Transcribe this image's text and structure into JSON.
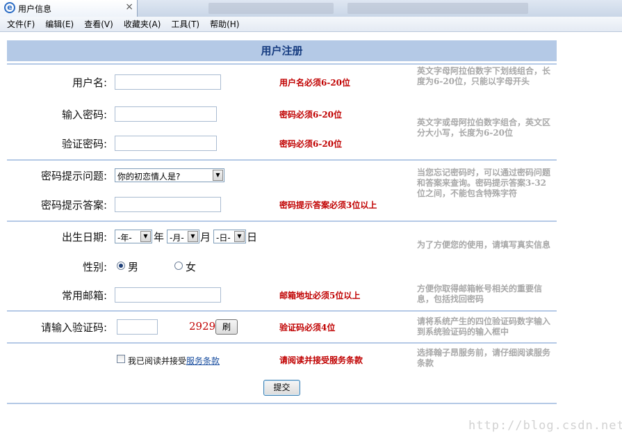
{
  "browser": {
    "tab_title": "用户信息",
    "tab_icon": "ie-icon",
    "close_glyph": "×"
  },
  "menu": [
    "文件(F)",
    "编辑(E)",
    "查看(V)",
    "收藏夹(A)",
    "工具(T)",
    "帮助(H)"
  ],
  "form": {
    "title": "用户注册",
    "username": {
      "label": "用户名:",
      "value": "",
      "error": "用户名必须6-20位",
      "hint": "英文字母阿拉伯数字下划线组合，长度为6-20位，只能以字母开头"
    },
    "password": {
      "label": "输入密码:",
      "value": "",
      "error": "密码必须6-20位"
    },
    "confirm_password": {
      "label": "验证密码:",
      "value": "",
      "error": "密码必须6-20位",
      "hint": "英文字或母阿拉伯数字组合，英文区分大小写，长度为6-20位"
    },
    "question": {
      "label": "密码提示问题:",
      "selected": "你的初恋情人是?",
      "hint": "当您忘记密码时，可以通过密码问题和答案来查询。密码提示答案3-32位之间，不能包含特殊字符"
    },
    "answer": {
      "label": "密码提示答案:",
      "value": "",
      "error": "密码提示答案必须3位以上"
    },
    "birthday": {
      "label": "出生日期:",
      "year": "-年-",
      "year_unit": "年",
      "month": "-月-",
      "month_unit": "月",
      "day": "-日-",
      "day_unit": "日"
    },
    "gender": {
      "label": "性别:",
      "male": "男",
      "female": "女",
      "selected": "male",
      "hint": "为了方便您的使用，请填写真实信息"
    },
    "email": {
      "label": "常用邮箱:",
      "value": "",
      "error": "邮箱地址必须5位以上",
      "hint": "方便你取得邮箱帐号相关的重要信息，包括找回密码"
    },
    "captcha": {
      "label": "请输入验证码:",
      "value": "",
      "code": "2929",
      "refresh_label": "刷",
      "error": "验证码必须4位",
      "hint": "请将系统产生的四位验证码数字输入到系统验证码的输入框中"
    },
    "agreement": {
      "text": "我已阅读并接受",
      "link": "服务条款",
      "checked": false,
      "error": "请阅读并接受服务条款",
      "hint": "选择翰子昂服务前，请仔细阅读服务条款"
    },
    "submit_label": "提交"
  },
  "watermark": "http://blog.csdn.net/",
  "colors": {
    "header_bg": "#b4c9e6",
    "header_text": "#163c80",
    "error": "#c00000",
    "hint": "#a8a8a8",
    "link": "#1b4fa0"
  }
}
